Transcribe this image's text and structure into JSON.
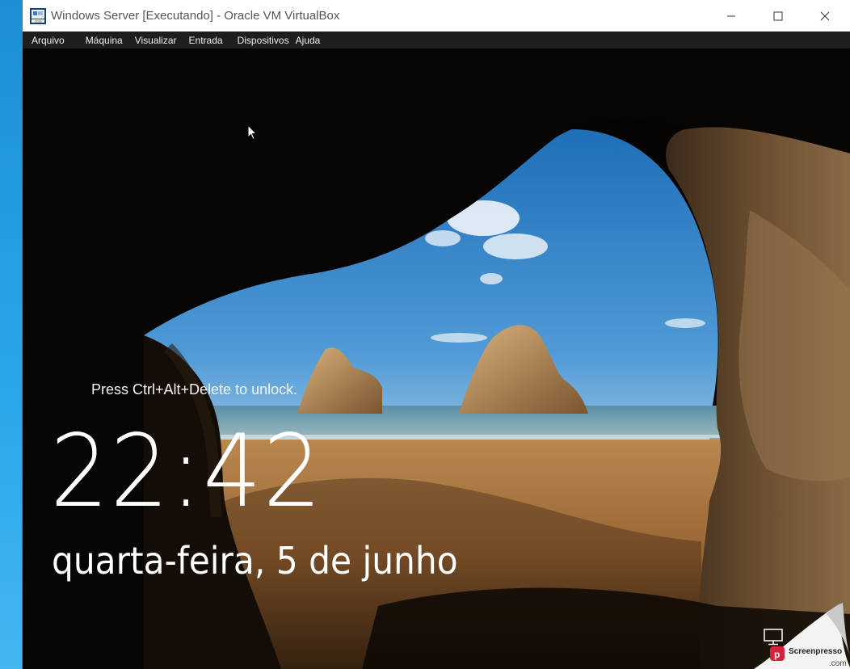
{
  "window": {
    "title": "Windows Server [Executando] - Oracle VM VirtualBox"
  },
  "menu": [
    "Arquivo",
    "Máquina",
    "Visualizar",
    "Entrada",
    "Dispositivos",
    "Ajuda"
  ],
  "lock_screen": {
    "unlock_hint": "Press Ctrl+Alt+Delete to unlock.",
    "time": "22:42",
    "date": "quarta-feira, 5 de junho"
  },
  "watermark": {
    "brand": "Screenpresso",
    "suffix": ".com"
  },
  "icons": {
    "app": "virtualbox-app-icon",
    "minimize": "minimize-icon",
    "maximize": "maximize-icon",
    "close": "close-icon",
    "network": "network-icon",
    "cursor": "mouse-pointer-icon"
  },
  "colors": {
    "menubar": "#1e1e1e",
    "desktop": "#1a9be0",
    "sky": "#2f7fc4",
    "sand": "#a7713c"
  }
}
